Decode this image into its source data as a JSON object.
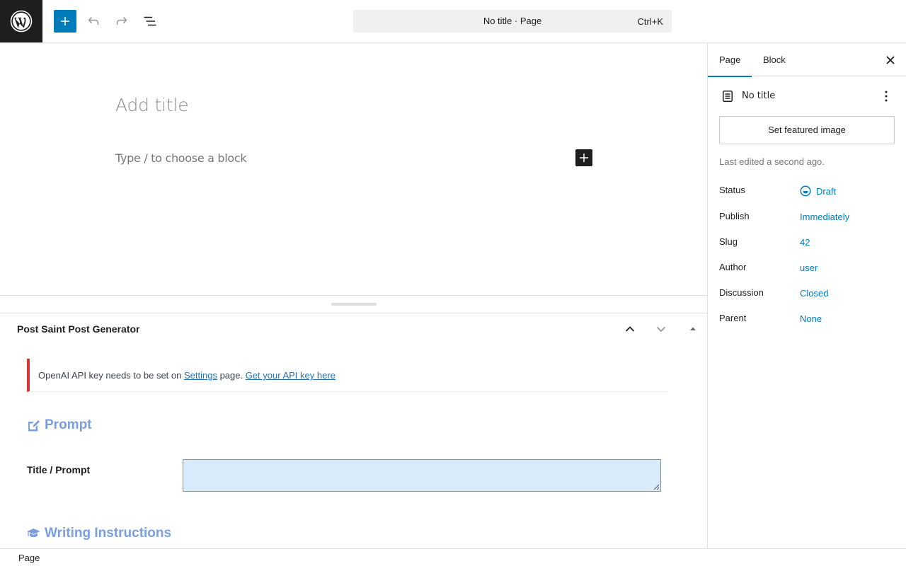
{
  "topbar": {
    "logo_icon": "wordpress-logo-icon",
    "add_icon": "plus-icon",
    "undo_icon": "undo-icon",
    "redo_icon": "redo-icon",
    "list_icon": "document-overview-icon",
    "command_title": "No title · Page",
    "command_shortcut": "Ctrl+K"
  },
  "editor": {
    "title_placeholder": "Add title",
    "block_placeholder": "Type / to choose a block",
    "inserter_icon": "plus-icon"
  },
  "metabox": {
    "title": "Post Saint Post Generator",
    "notice": {
      "text_before": "OpenAI API key needs to be set on ",
      "settings_link": "Settings",
      "text_middle": " page. ",
      "api_link": "Get your API key here"
    },
    "prompt_heading": "Prompt",
    "prompt_heading_icon": "edit-icon",
    "title_prompt_label": "Title / Prompt",
    "title_prompt_value": "",
    "writing_heading": "Writing Instructions",
    "writing_heading_icon": "graduation-cap-icon"
  },
  "sidebar": {
    "tabs": [
      {
        "label": "Page",
        "active": true
      },
      {
        "label": "Block",
        "active": false
      }
    ],
    "doc_title": "No title",
    "featured_image_button": "Set featured image",
    "last_edited": "Last edited a second ago.",
    "rows": [
      {
        "label": "Status",
        "value": "Draft"
      },
      {
        "label": "Publish",
        "value": "Immediately"
      },
      {
        "label": "Slug",
        "value": "42"
      },
      {
        "label": "Author",
        "value": "user"
      },
      {
        "label": "Discussion",
        "value": "Closed"
      },
      {
        "label": "Parent",
        "value": "None"
      }
    ]
  },
  "footer": {
    "breadcrumb": "Page"
  },
  "colors": {
    "accent": "#007cba",
    "error": "#d63638",
    "heading_blue": "#7b9ee0",
    "input_bg": "#d8ebfb"
  }
}
